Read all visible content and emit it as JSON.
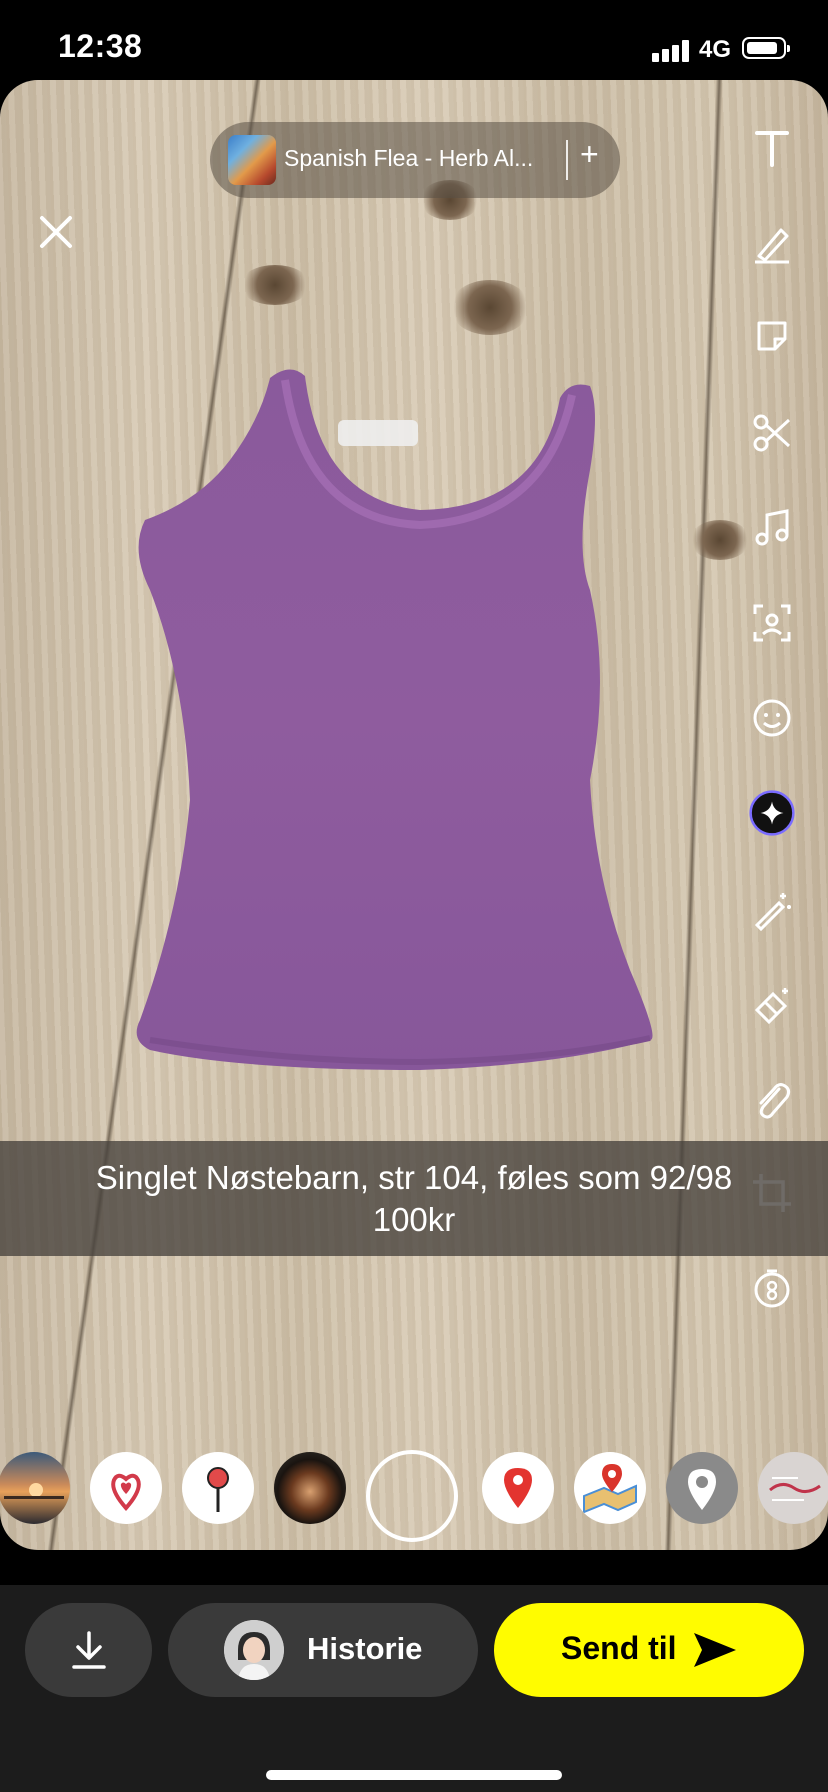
{
  "status_bar": {
    "time": "12:38",
    "network": "4G"
  },
  "music": {
    "title": "Spanish Flea - Herb Al...",
    "add_label": "+"
  },
  "caption": {
    "line1": "Singlet Nøstebarn, str 104, føles som 92/98",
    "line2": "100kr"
  },
  "side_tools": [
    "text-tool",
    "pen-tool",
    "sticker-tool",
    "scissors-tool",
    "music-tool",
    "lens-scan-tool",
    "bitmoji-tool",
    "ai-sparkle-tool",
    "magic-wand-tool",
    "eraser-tool",
    "paperclip-tool",
    "crop-tool",
    "timer-tool"
  ],
  "lenses": [
    "sunset-lens",
    "heart-pin-lens",
    "pushpin-lens",
    "coffee-lens",
    "location-pin-lens",
    "map-lens",
    "gray-pin-lens",
    "saturday-lens"
  ],
  "bottom": {
    "story_label": "Historie",
    "send_label": "Send til"
  },
  "colors": {
    "send_accent": "#fffc00",
    "bar_bg": "#1c1c1c",
    "pill_bg": "#3a3a3a"
  }
}
